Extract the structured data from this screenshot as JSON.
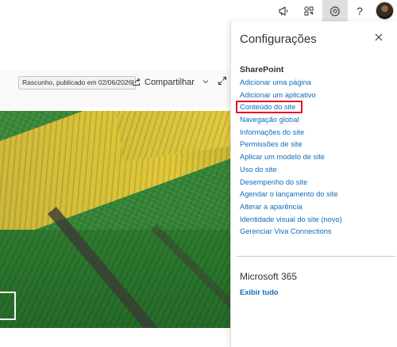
{
  "topbar": {
    "icons": [
      "megaphone-icon",
      "app-launcher-icon",
      "gear-icon",
      "help-icon"
    ],
    "help_glyph": "?",
    "active_icon": "gear-icon"
  },
  "page": {
    "draft_status": "Rascunho, publicado em 02/06/2026",
    "share_label": "Compartilhar",
    "share_icon": "share-icon",
    "expand_icon": "expand-icon"
  },
  "settings_panel": {
    "title": "Configurações",
    "close_icon": "close-icon",
    "sharepoint_section": {
      "heading": "SharePoint",
      "links": [
        {
          "label": "Adicionar uma página",
          "highlighted": false
        },
        {
          "label": "Adicionar um aplicativo",
          "highlighted": false
        },
        {
          "label": "Conteúdo do site",
          "highlighted": true
        },
        {
          "label": "Navegação global",
          "highlighted": false
        },
        {
          "label": "Informações do site",
          "highlighted": false
        },
        {
          "label": "Permissões de site",
          "highlighted": false
        },
        {
          "label": "Aplicar um modelo de site",
          "highlighted": false
        },
        {
          "label": "Uso do site",
          "highlighted": false
        },
        {
          "label": "Desempenho do site",
          "highlighted": false
        },
        {
          "label": "Agendar o lançamento do site",
          "highlighted": false
        },
        {
          "label": "Alterar a aparência",
          "highlighted": false
        },
        {
          "label": "Identidade visual do site (novo)",
          "highlighted": false
        },
        {
          "label": "Gerenciar Viva Connections",
          "highlighted": false
        }
      ]
    },
    "microsoft365_section": {
      "heading": "Microsoft 365",
      "show_all": "Exibir tudo"
    }
  },
  "colors": {
    "link": "#0f6cbd",
    "highlight_box": "#e81123",
    "active_icon_bg": "#e1dfdd"
  }
}
